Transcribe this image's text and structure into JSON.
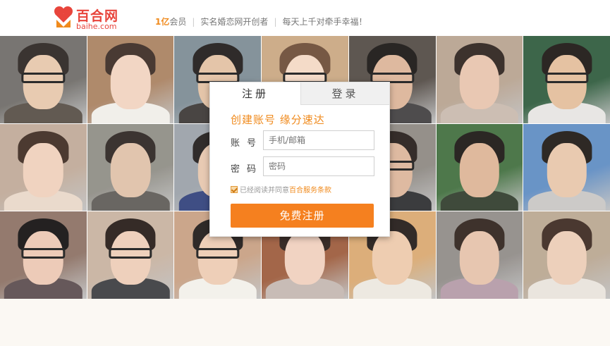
{
  "header": {
    "logo_cn": "百合网",
    "logo_en": "baihe.com",
    "slogan_highlight": "1亿",
    "slogan_member": "会员",
    "slogan_2": "实名婚恋网开创者",
    "slogan_3": "每天上千对牵手幸福！",
    "brand_color": "#e8453c",
    "accent_color": "#f08a1c"
  },
  "register_panel": {
    "tab_register": "注册",
    "tab_login": "登录",
    "tagline": "创建账号 缘分速达",
    "account_label": "账号",
    "account_placeholder": "手机/邮箱",
    "password_label": "密码",
    "password_placeholder": "密码",
    "agree_text": "已经阅读并同意",
    "agree_link": "百合服务条款",
    "agree_checked": true,
    "submit_label": "免费注册",
    "button_color": "#f5801f"
  },
  "photo_grid": {
    "rows": 3,
    "columns": 7
  }
}
